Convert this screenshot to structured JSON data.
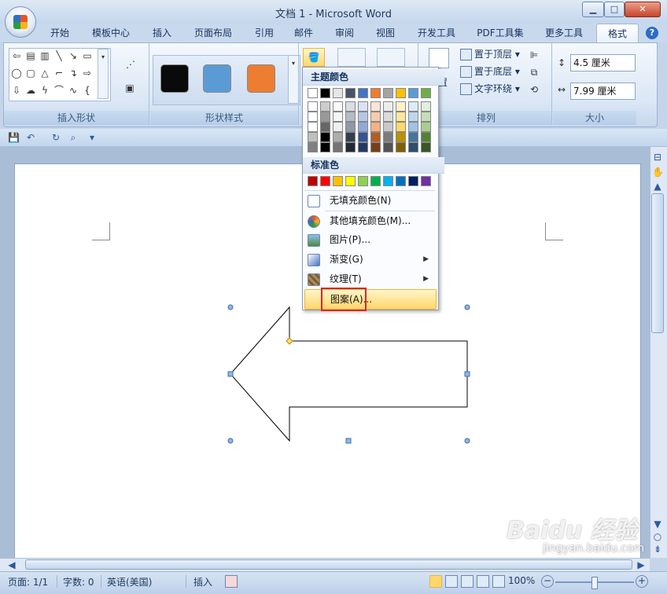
{
  "window": {
    "title": "文档 1 - Microsoft Word",
    "minimize": "▁",
    "maximize": "□",
    "close": "✕"
  },
  "tabs": [
    "开始",
    "模板中心",
    "插入",
    "页面布局",
    "引用",
    "邮件",
    "审阅",
    "视图",
    "开发工具",
    "PDF工具集",
    "更多工具",
    "格式"
  ],
  "active_tab": "格式",
  "help": "?",
  "ribbon": {
    "groups": {
      "insert_shapes": "插入形状",
      "shape_styles": "形状样式",
      "arrange": "排列",
      "size": "大小"
    },
    "style_swatches": [
      "#0a0a0a",
      "#5b9bd5",
      "#ed7d31"
    ],
    "arrange": {
      "bring_front": "置于顶层",
      "send_back": "置于底层",
      "text_wrap": "文字环绕",
      "position_partial": "置"
    },
    "size": {
      "height": "4.5 厘米",
      "width": "7.99 厘米"
    }
  },
  "menu": {
    "theme_colors_title": "主题颜色",
    "standard_colors_title": "标准色",
    "theme_colors": [
      "#ffffff",
      "#000000",
      "#e7e6e6",
      "#44546a",
      "#4472c4",
      "#ed7d31",
      "#a5a5a5",
      "#ffc000",
      "#5b9bd5",
      "#70ad47"
    ],
    "standard_colors": [
      "#c00000",
      "#ff0000",
      "#ffc000",
      "#ffff00",
      "#92d050",
      "#00b050",
      "#00b0f0",
      "#0070c0",
      "#002060",
      "#7030a0"
    ],
    "items": {
      "no_fill": "无填充颜色(N)",
      "more_colors": "其他填充颜色(M)...",
      "picture": "图片(P)...",
      "gradient": "渐变(G)",
      "texture": "纹理(T)",
      "pattern": "图案(A)..."
    },
    "submenu_arrow": "▶"
  },
  "status": {
    "page": "页面: 1/1",
    "words": "字数: 0",
    "language": "英语(美国)",
    "mode": "插入",
    "zoom": "100%",
    "zoom_out": "−",
    "zoom_in": "+"
  },
  "watermark": {
    "brand": "Baidu 经验",
    "url": "jingyan.baidu.com"
  },
  "colors": {
    "accent": "#2c6cc2",
    "highlight": "#d9262b",
    "menu_highlight": "#ffd66b"
  }
}
